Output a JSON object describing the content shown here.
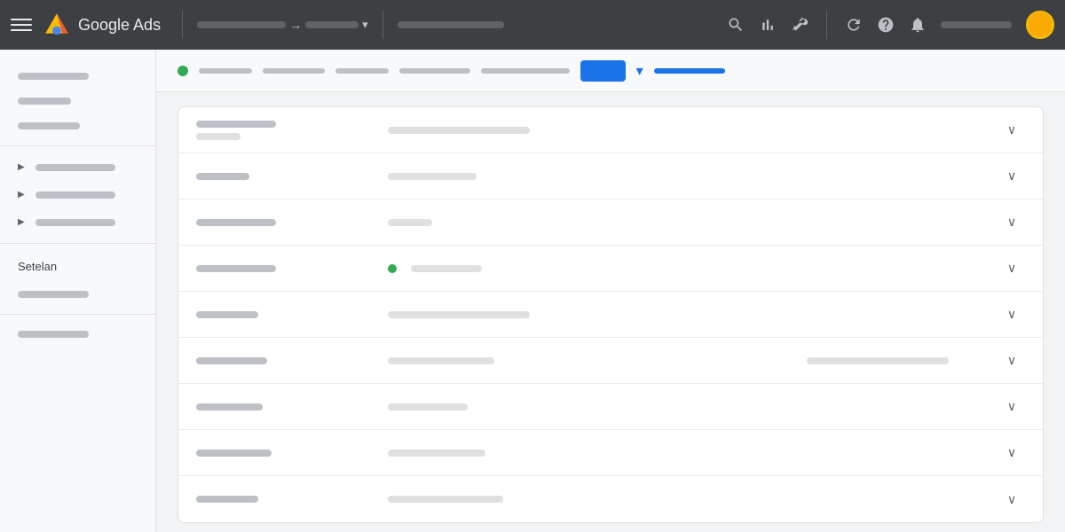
{
  "app": {
    "title": "Google Ads",
    "logo_alt": "Google Ads logo"
  },
  "topnav": {
    "hamburger_label": "Menu",
    "breadcrumb_arrow": "→",
    "dropdown_arrow": "▾",
    "icons": [
      "search",
      "bar-chart",
      "wrench",
      "refresh",
      "help",
      "bell"
    ],
    "account_placeholder": "account",
    "avatar_alt": "User avatar"
  },
  "sidebar": {
    "settings_label": "Setelan",
    "items": [
      {
        "id": "item-1",
        "label": "",
        "width": 80,
        "has_arrow": false
      },
      {
        "id": "item-2",
        "label": "",
        "width": 60,
        "has_arrow": false
      },
      {
        "id": "item-3",
        "label": "",
        "width": 70,
        "has_arrow": false
      },
      {
        "id": "item-4",
        "label": "",
        "width": 90,
        "has_arrow": true
      },
      {
        "id": "item-5",
        "label": "",
        "width": 90,
        "has_arrow": true
      },
      {
        "id": "item-6",
        "label": "",
        "width": 90,
        "has_arrow": true
      },
      {
        "id": "item-7",
        "label": "",
        "width": 80,
        "has_arrow": false
      },
      {
        "id": "item-8",
        "label": "",
        "width": 80,
        "has_arrow": false
      },
      {
        "id": "item-9",
        "label": "",
        "width": 80,
        "has_arrow": false
      }
    ]
  },
  "subnav": {
    "items": [
      {
        "id": "sn-1",
        "width": 60,
        "active": false
      },
      {
        "id": "sn-2",
        "width": 70,
        "active": false
      },
      {
        "id": "sn-3",
        "width": 60,
        "active": false
      },
      {
        "id": "sn-4",
        "width": 80,
        "active": false
      },
      {
        "id": "sn-5",
        "width": 100,
        "active": false
      },
      {
        "id": "sn-6",
        "width": 50,
        "active": true,
        "is_button": true,
        "label": ""
      },
      {
        "id": "sn-7",
        "width": 80,
        "active": true,
        "is_link": true
      }
    ],
    "dropdown_arrow": "▾"
  },
  "table": {
    "rows": [
      {
        "id": "row-1",
        "col1_width": 90,
        "col1_width2": 50,
        "col2_width": 160,
        "col3_visible": false,
        "has_dot": false
      },
      {
        "id": "row-2",
        "col1_width": 60,
        "col1_width2": 0,
        "col2_width": 100,
        "col3_visible": false,
        "has_dot": false
      },
      {
        "id": "row-3",
        "col1_width": 90,
        "col1_width2": 0,
        "col2_width": 50,
        "col3_visible": false,
        "has_dot": false
      },
      {
        "id": "row-4",
        "col1_width": 90,
        "col1_width2": 0,
        "col2_width": 80,
        "col3_visible": false,
        "has_dot": true
      },
      {
        "id": "row-5",
        "col1_width": 70,
        "col1_width2": 0,
        "col2_width": 160,
        "col3_visible": false,
        "has_dot": false
      },
      {
        "id": "row-6",
        "col1_width": 80,
        "col1_width2": 0,
        "col2_width": 120,
        "col3_width": 160,
        "col3_visible": true,
        "has_dot": false
      },
      {
        "id": "row-7",
        "col1_width": 75,
        "col1_width2": 0,
        "col2_width": 90,
        "col3_visible": false,
        "has_dot": false
      },
      {
        "id": "row-8",
        "col1_width": 85,
        "col1_width2": 0,
        "col2_width": 110,
        "col3_visible": false,
        "has_dot": false
      },
      {
        "id": "row-9",
        "col1_width": 70,
        "col1_width2": 0,
        "col2_width": 130,
        "col3_visible": false,
        "has_dot": false
      }
    ]
  }
}
